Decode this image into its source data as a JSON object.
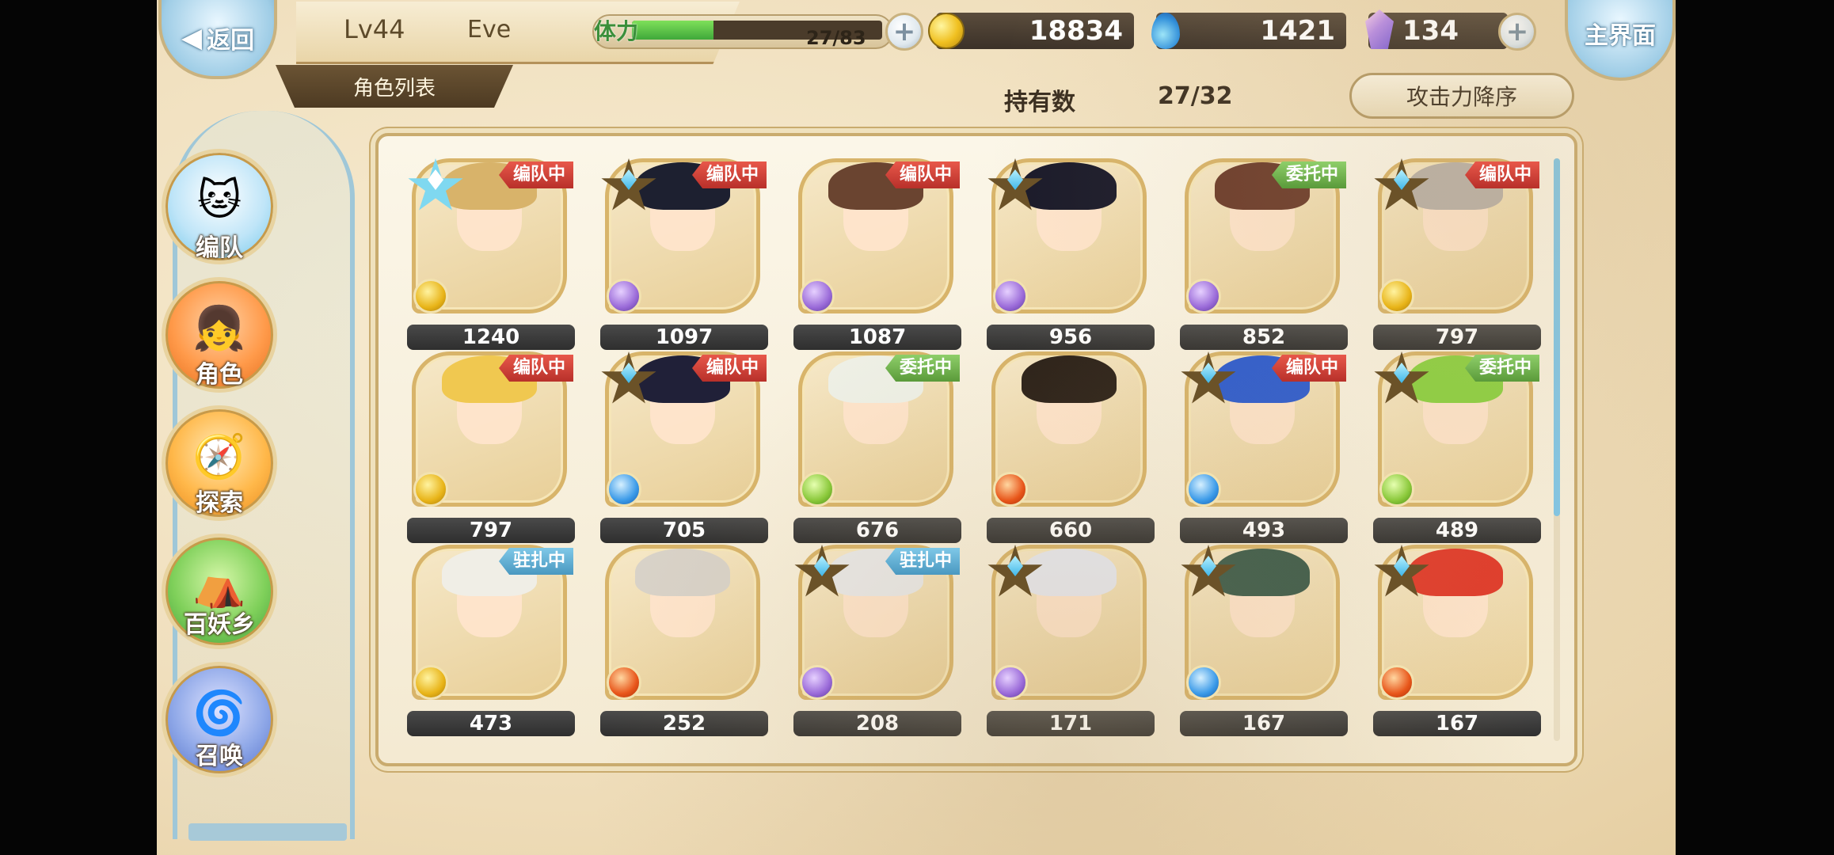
{
  "header": {
    "back_label": "返回",
    "home_label": "主界面",
    "level": "Lv44",
    "player_name": "Eve",
    "list_tab": "角色列表",
    "stamina_label": "体力",
    "stamina_text": "27/83",
    "stamina_fraction": 0.325,
    "gold": "18834",
    "spirit": "1421",
    "crystal": "134",
    "plus": "+"
  },
  "roster_header": {
    "owned_label": "持有数",
    "owned_count": "27/32",
    "sort_label": "攻击力降序"
  },
  "menu": [
    {
      "label": "编队",
      "icon": "team-icon"
    },
    {
      "label": "角色",
      "icon": "character-icon"
    },
    {
      "label": "探索",
      "icon": "explore-icon"
    },
    {
      "label": "百妖乡",
      "icon": "village-icon"
    },
    {
      "label": "召唤",
      "icon": "summon-icon"
    }
  ],
  "cards": [
    {
      "atk": "1240",
      "status": "编队中",
      "status_color": "red",
      "element": "gold",
      "star": "big",
      "hair": "#d8b36a"
    },
    {
      "atk": "1097",
      "status": "编队中",
      "status_color": "red",
      "element": "purple",
      "star": "normal",
      "hair": "#1d2030"
    },
    {
      "atk": "1087",
      "status": "编队中",
      "status_color": "red",
      "element": "purple",
      "star": "none",
      "hair": "#6a4430"
    },
    {
      "atk": "956",
      "status": "",
      "status_color": "",
      "element": "purple",
      "star": "normal",
      "hair": "#1a1a2a"
    },
    {
      "atk": "852",
      "status": "委托中",
      "status_color": "green",
      "element": "purple",
      "star": "none",
      "hair": "#6a3a2a"
    },
    {
      "atk": "797",
      "status": "编队中",
      "status_color": "red",
      "element": "gold",
      "star": "small",
      "hair": "#b8b0a8"
    },
    {
      "atk": "797",
      "status": "编队中",
      "status_color": "red",
      "element": "gold",
      "star": "none",
      "hair": "#f0c850"
    },
    {
      "atk": "705",
      "status": "编队中",
      "status_color": "red",
      "element": "blue",
      "star": "normal",
      "hair": "#202038"
    },
    {
      "atk": "676",
      "status": "委托中",
      "status_color": "green",
      "element": "green",
      "star": "none",
      "hair": "#eef0e6"
    },
    {
      "atk": "660",
      "status": "",
      "status_color": "",
      "element": "red",
      "star": "none",
      "hair": "#2a2018"
    },
    {
      "atk": "493",
      "status": "编队中",
      "status_color": "red",
      "element": "blue",
      "star": "normal",
      "hair": "#2a5ad0"
    },
    {
      "atk": "489",
      "status": "委托中",
      "status_color": "green",
      "element": "green",
      "star": "normal",
      "hair": "#8ad040"
    },
    {
      "atk": "473",
      "status": "驻扎中",
      "status_color": "blue",
      "element": "gold",
      "star": "none",
      "hair": "#f0eee6"
    },
    {
      "atk": "252",
      "status": "",
      "status_color": "",
      "element": "red",
      "star": "none",
      "hair": "#d8d2c8"
    },
    {
      "atk": "208",
      "status": "驻扎中",
      "status_color": "blue",
      "element": "purple",
      "star": "normal",
      "hair": "#e8e8e8"
    },
    {
      "atk": "171",
      "status": "",
      "status_color": "",
      "element": "purple",
      "star": "normal",
      "hair": "#e6e8f0"
    },
    {
      "atk": "167",
      "status": "",
      "status_color": "",
      "element": "blue",
      "star": "normal",
      "hair": "#3a5a4a"
    },
    {
      "atk": "167",
      "status": "",
      "status_color": "",
      "element": "red",
      "star": "normal",
      "hair": "#e03a2a"
    }
  ]
}
